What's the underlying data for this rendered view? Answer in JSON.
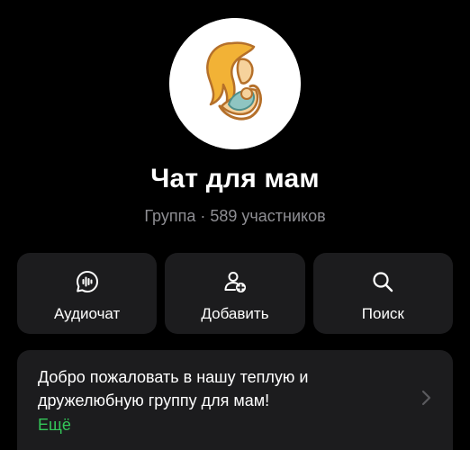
{
  "group": {
    "title": "Чат для мам",
    "subtitle": "Группа · 589 участников"
  },
  "actions": [
    {
      "label": "Аудиочат",
      "icon": "audio-waves-icon"
    },
    {
      "label": "Добавить",
      "icon": "add-person-icon"
    },
    {
      "label": "Поиск",
      "icon": "search-icon"
    }
  ],
  "about": {
    "text": "Добро пожаловать в нашу теплую и дружелюбную группу для мам!",
    "more_label": "Ещё",
    "chevron_icon": "chevron-right-icon"
  },
  "colors": {
    "background": "#000000",
    "card": "#1c1c1e",
    "muted": "#8e8e93",
    "accent": "#34c759",
    "logo_hair": "#f2b236",
    "logo_skin": "#f6d29c",
    "logo_baby": "#8fc5c2"
  }
}
